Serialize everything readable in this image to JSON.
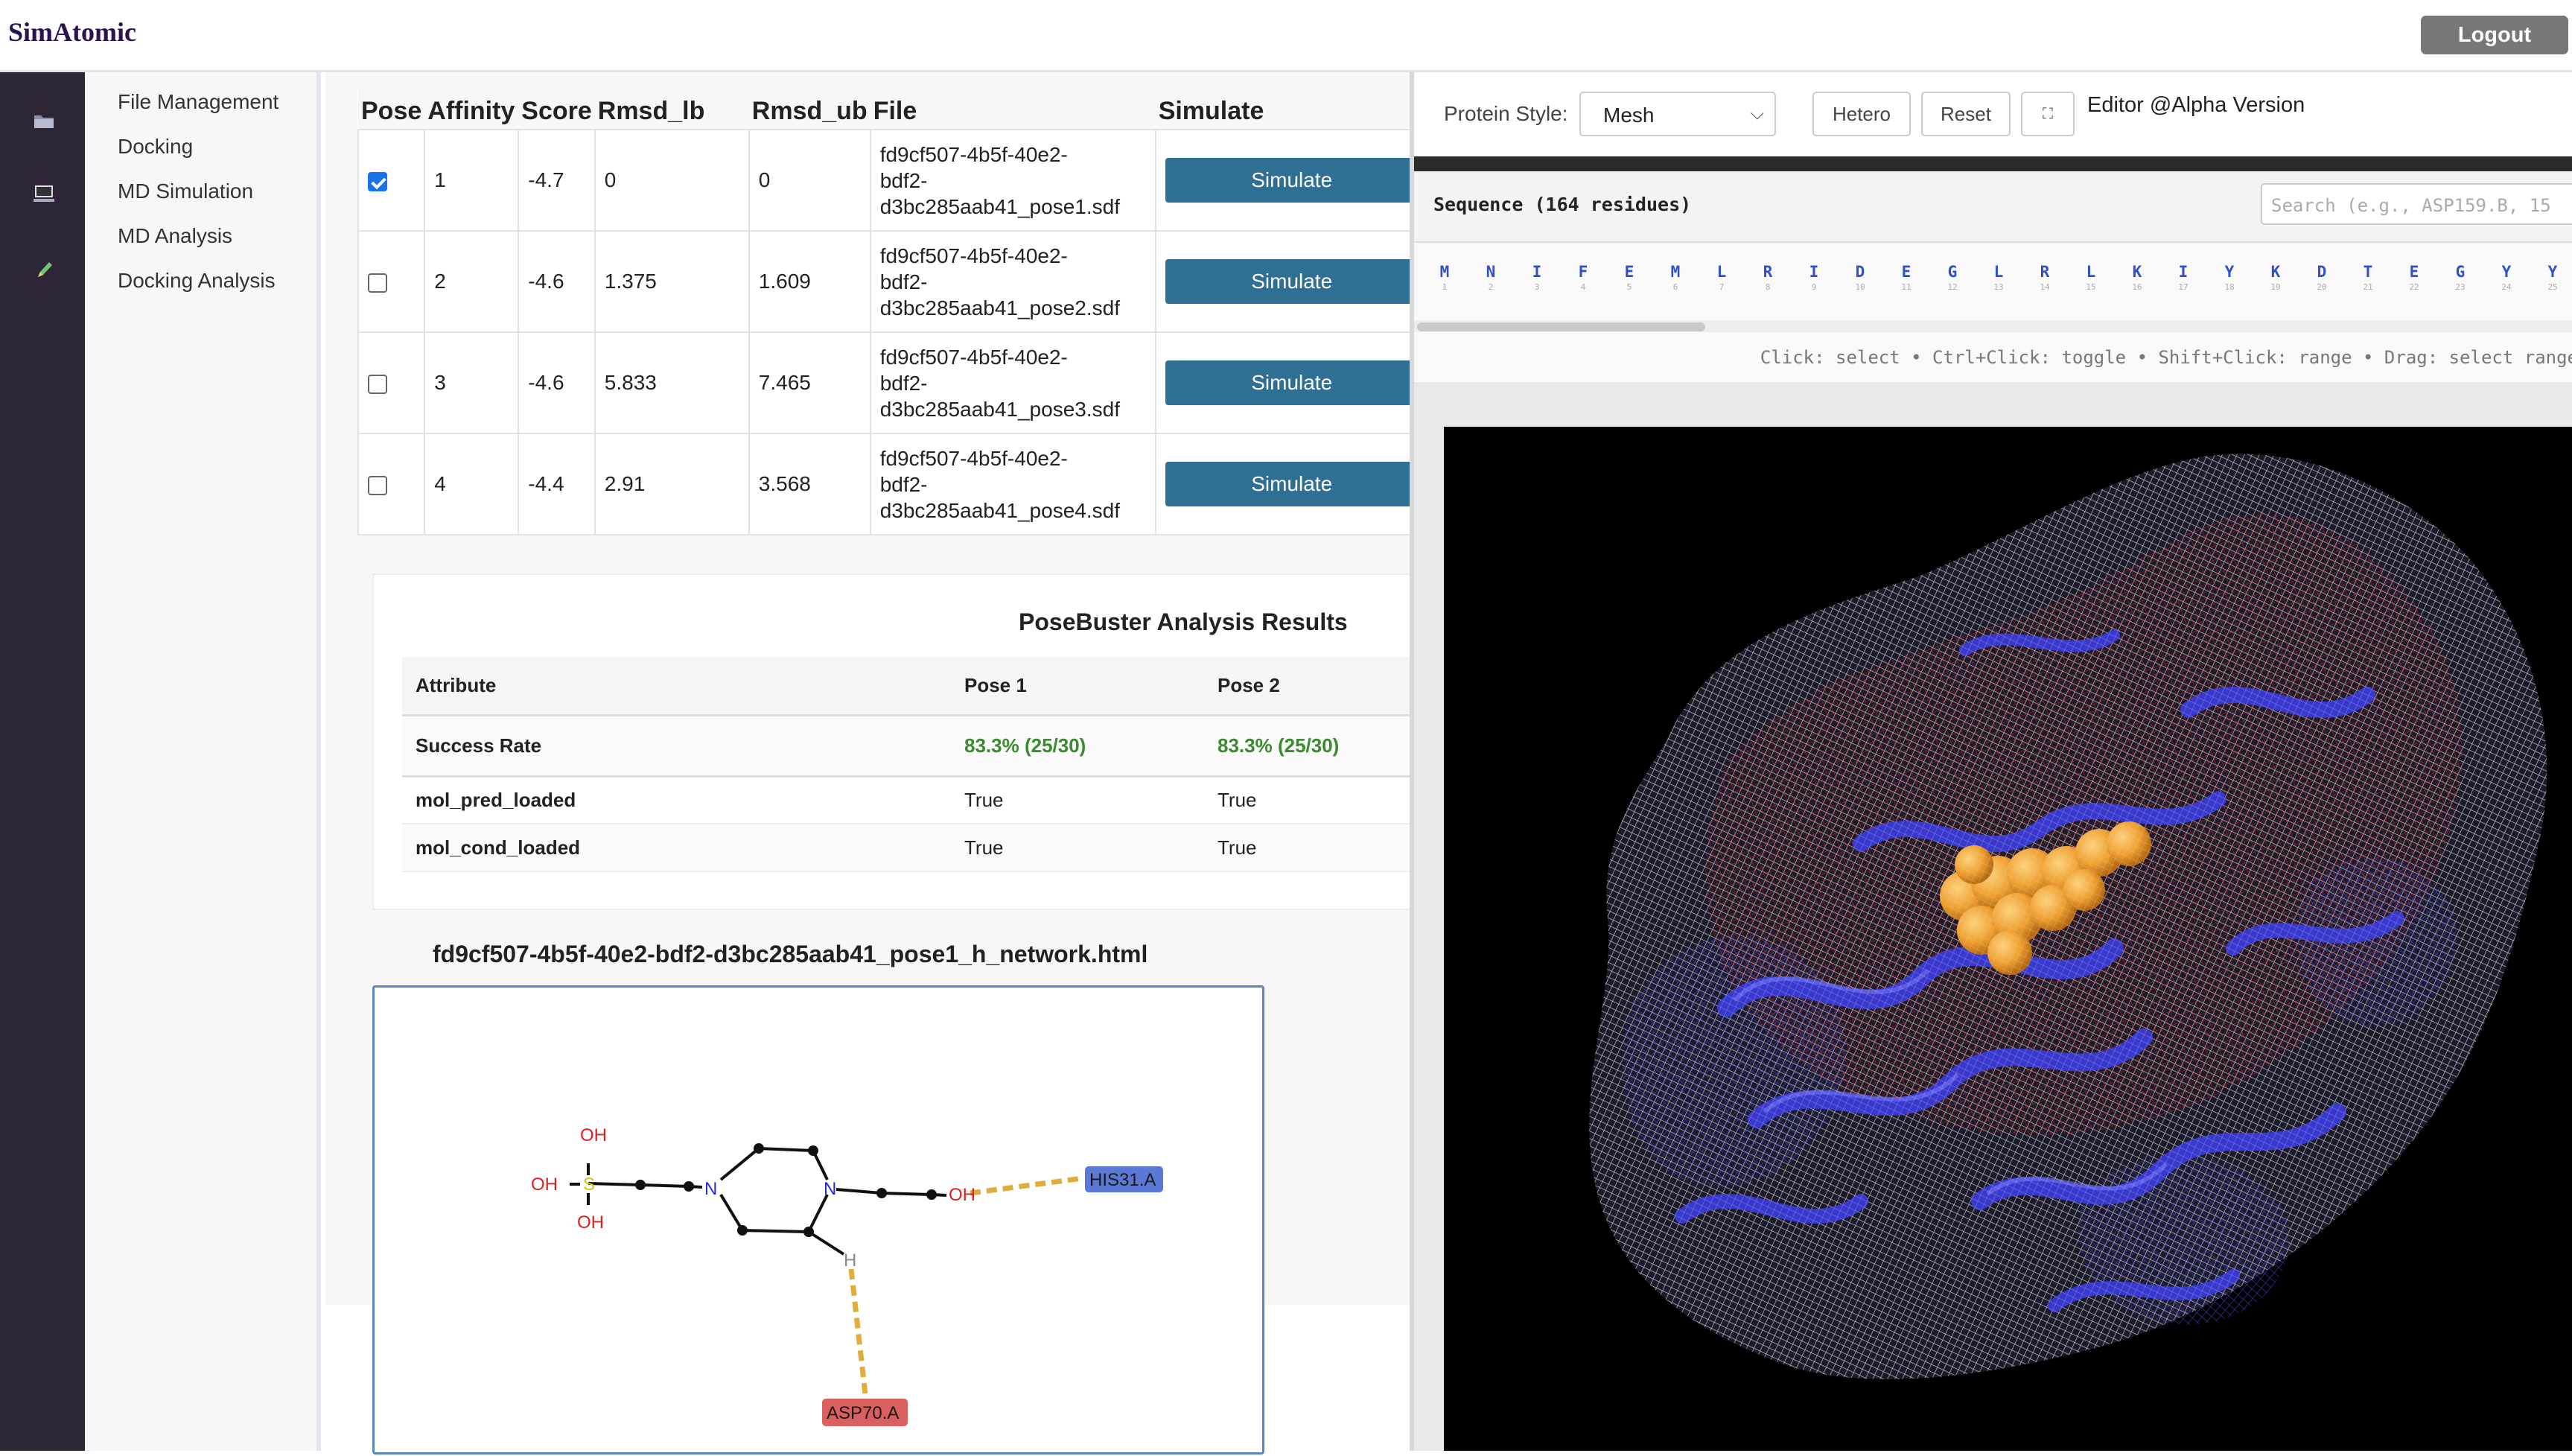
{
  "app": {
    "title": "SimAtomic",
    "logout_label": "Logout"
  },
  "rail": {
    "icons": [
      "folder-icon",
      "monitor-icon",
      "pencil-icon"
    ]
  },
  "nav": {
    "items": [
      "File Management",
      "Docking",
      "MD Simulation",
      "MD Analysis",
      "Docking Analysis"
    ]
  },
  "poses_table": {
    "headers": [
      "Pose",
      "Affinity",
      "Score",
      "Rmsd_lb",
      "Rmsd_ub",
      "File",
      "Simulate"
    ],
    "rows": [
      {
        "checked": true,
        "pose": "1",
        "score": "-4.7",
        "rmsd_lb": "0",
        "rmsd_ub": "0",
        "file_lines": [
          "fd9cf507-4b5f-40e2-",
          "bdf2-",
          "d3bc285aab41_pose1.sdf"
        ],
        "button": "Simulate"
      },
      {
        "checked": false,
        "pose": "2",
        "score": "-4.6",
        "rmsd_lb": "1.375",
        "rmsd_ub": "1.609",
        "file_lines": [
          "fd9cf507-4b5f-40e2-",
          "bdf2-",
          "d3bc285aab41_pose2.sdf"
        ],
        "button": "Simulate"
      },
      {
        "checked": false,
        "pose": "3",
        "score": "-4.6",
        "rmsd_lb": "5.833",
        "rmsd_ub": "7.465",
        "file_lines": [
          "fd9cf507-4b5f-40e2-",
          "bdf2-",
          "d3bc285aab41_pose3.sdf"
        ],
        "button": "Simulate"
      },
      {
        "checked": false,
        "pose": "4",
        "score": "-4.4",
        "rmsd_lb": "2.91",
        "rmsd_ub": "3.568",
        "file_lines": [
          "fd9cf507-4b5f-40e2-",
          "bdf2-",
          "d3bc285aab41_pose4.sdf"
        ],
        "button": "Simulate"
      }
    ]
  },
  "posebuster": {
    "title": "PoseBuster Analysis Results",
    "headers": [
      "Attribute",
      "Pose 1",
      "Pose 2"
    ],
    "rows": [
      {
        "attr": "Success Rate",
        "pose1": "83.3% (25/30)",
        "pose2": "83.3% (25/30)"
      },
      {
        "attr": "mol_pred_loaded",
        "pose1": "True",
        "pose2": "True"
      },
      {
        "attr": "mol_cond_loaded",
        "pose1": "True",
        "pose2": "True"
      }
    ]
  },
  "network": {
    "title": "fd9cf507-4b5f-40e2-bdf2-d3bc285aab41_pose1_h_network.html",
    "atoms": {
      "oh_top": "OH",
      "oh_left": "OH",
      "oh_bottom": "OH",
      "s": "S",
      "n1": "N",
      "n2": "N",
      "oh_right": "OH",
      "h": "H"
    },
    "residues": {
      "his": "HIS31.A",
      "asp": "ASP70.A"
    },
    "colors": {
      "his": "#5b78d6",
      "asp": "#d9605e",
      "hbond": "#e0ad3c"
    }
  },
  "viewer_controls": {
    "protein_style_label": "Protein Style:",
    "protein_style_value": "Mesh",
    "hetero_label": "Hetero",
    "reset_label": "Reset",
    "fullscreen_icon": "fullscreen-icon",
    "editor_label": "Editor @Alpha Version"
  },
  "sequence": {
    "title": "Sequence (164 residues)",
    "search_placeholder": "Search (e.g., ASP159.B, 15",
    "residues": [
      "M",
      "N",
      "I",
      "F",
      "E",
      "M",
      "L",
      "R",
      "I",
      "D",
      "E",
      "G",
      "L",
      "R",
      "L",
      "K",
      "I",
      "Y",
      "K",
      "D",
      "T",
      "E",
      "G",
      "Y",
      "Y"
    ],
    "numbers": [
      "1",
      "2",
      "3",
      "4",
      "5",
      "6",
      "7",
      "8",
      "9",
      "10",
      "11",
      "12",
      "13",
      "14",
      "15",
      "16",
      "17",
      "18",
      "19",
      "20",
      "21",
      "22",
      "23",
      "24",
      "25"
    ],
    "hint": "Click: select • Ctrl+Click: toggle • Shift+Click: range • Drag: select range"
  },
  "colors": {
    "brand": "#2b1352",
    "rail": "#2e2536",
    "accent_button": "#2f6f94",
    "success": "#3a8a2e",
    "residue_letter": "#2f50c8"
  }
}
